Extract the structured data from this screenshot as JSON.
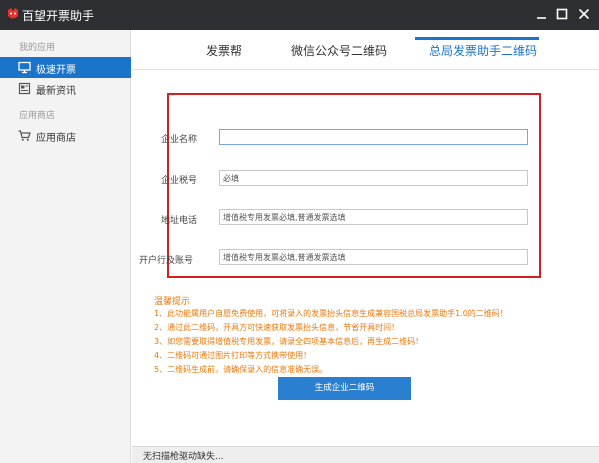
{
  "window": {
    "title": "百望开票助手"
  },
  "sidebar": {
    "sections": [
      {
        "label": "我的应用"
      },
      {
        "label": "应用商店"
      }
    ],
    "items": [
      {
        "label": "极速开票",
        "icon": "monitor-icon",
        "active": true
      },
      {
        "label": "最新资讯",
        "icon": "news-icon",
        "active": false
      },
      {
        "label": "应用商店",
        "icon": "cart-icon",
        "active": false
      }
    ]
  },
  "tabs": [
    {
      "label": "发票帮",
      "active": false
    },
    {
      "label": "微信公众号二维码",
      "active": false
    },
    {
      "label": "总局发票助手二维码",
      "active": true
    }
  ],
  "form": {
    "fields": [
      {
        "label": "企业名称",
        "value": "",
        "placeholder": ""
      },
      {
        "label": "企业税号",
        "value": "",
        "placeholder": "必填"
      },
      {
        "label": "地址电话",
        "value": "",
        "placeholder": "增值税专用发票必填,普通发票选填"
      },
      {
        "label": "开户行及账号",
        "value": "",
        "placeholder": "增值税专用发票必填,普通发票选填"
      }
    ]
  },
  "tips": {
    "title": "温馨提示",
    "items": [
      "1、此功能属用户自愿免费使用，可将录入的发票抬头信息生成兼容国税总局发票助手1.0的二维码！",
      "2、通过此二维码，开具方可快速获取发票抬头信息，节省开具时间！",
      "3、如您需要取得增值税专用发票，请录全四项基本信息后，再生成二维码！",
      "4、二维码可通过图片打印等方式携带使用！",
      "5、二维码生成前，请确保录入的信息准确无误。"
    ]
  },
  "generate_button": {
    "label": "生成企业二维码"
  },
  "status": {
    "text": "无扫描枪驱动缺失..."
  },
  "colors": {
    "titlebar": "#2d2f33",
    "accent": "#1a74c9",
    "tip_text": "#e8790c",
    "annotation": "#d32020"
  }
}
